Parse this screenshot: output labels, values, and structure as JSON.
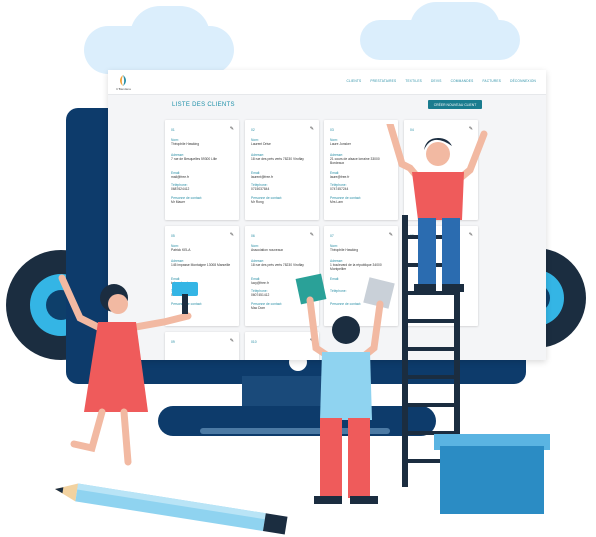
{
  "app": {
    "brand": "C'Bandana"
  },
  "nav": {
    "items": [
      "CLIENTS",
      "PRESTATAIRES",
      "TEXTILES",
      "DEVIS",
      "COMMANDES",
      "FACTURES",
      "DÉCONNEXION"
    ]
  },
  "page": {
    "title": "LISTE DES CLIENTS",
    "new_button": "CRÉER NOUVEAU CLIENT"
  },
  "labels": {
    "nom": "Nom:",
    "adresse": "Adresse:",
    "email": "Email:",
    "telephone": "Téléphone:",
    "contact": "Personne de contact:"
  },
  "cards": [
    {
      "num": "01",
      "nom": "Théophile Hawking",
      "adresse": "7 rue de Besquelles 59300 Lille",
      "email": "mail@free.fr",
      "tel": "0687624412",
      "contact": "Mr Mauer"
    },
    {
      "num": "02",
      "nom": "Laurent Drise",
      "adresse": "18 rue des prés verts 78230 Viroflay",
      "email": "laurent@free.fr",
      "tel": "0715037844",
      "contact": "Mr Rong"
    },
    {
      "num": "03",
      "nom": "Laure Jonsker",
      "adresse": "21 cours de alsace lorraine 33000 Bordeaux",
      "email": "laure@free.fr",
      "tel": "0747457244",
      "contact": "Mrs Lam"
    },
    {
      "num": "04",
      "nom": "",
      "adresse": "",
      "email": "",
      "tel": "",
      "contact": ""
    },
    {
      "num": "05",
      "nom": "Patrick KELA",
      "adresse": "145 impasse Montaigne 13008 Marseille",
      "email": "kela.school",
      "tel": "0612221193",
      "contact": ""
    },
    {
      "num": "06",
      "nom": "Association nouveaux",
      "adresse": "18 rue des prés verts 78230 Viroflay",
      "email": "lucy@free.fr",
      "tel": "0607451412",
      "contact": "Mac Dom"
    },
    {
      "num": "07",
      "nom": "Théophile Hawking",
      "adresse": "1 boulevard de la république 34000 Montpellier",
      "email": "",
      "tel": "",
      "contact": ""
    },
    {
      "num": "08",
      "nom": "",
      "adresse": "",
      "email": "",
      "tel": "",
      "contact": ""
    },
    {
      "num": "09",
      "nom": "",
      "adresse": "",
      "email": "",
      "tel": "",
      "contact": ""
    },
    {
      "num": "010",
      "nom": "",
      "adresse": "",
      "email": "",
      "tel": "",
      "contact": ""
    }
  ],
  "colors": {
    "accent": "#2a8fa6",
    "button": "#1a7c8f",
    "monitor": "#0d3b6b",
    "gear": "#1b2d40",
    "gear_inner": "#34b5e5",
    "cloud": "#dbeefc",
    "shirt_red": "#ef5b5b",
    "shirt_blue": "#8fd3f0"
  },
  "icons": [
    "pencil-icon",
    "brand-logo-icon"
  ]
}
